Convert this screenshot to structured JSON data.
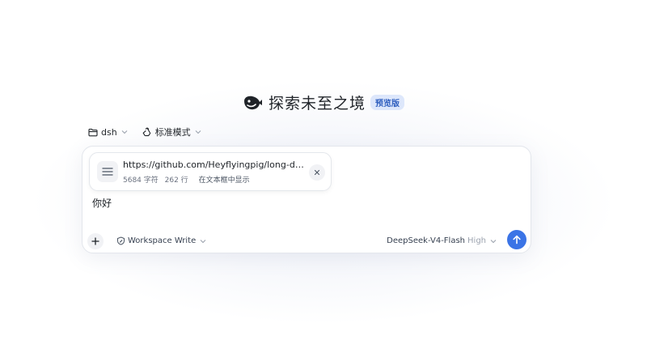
{
  "brand": {
    "title": "探索未至之境",
    "badge": "预览版"
  },
  "selectors": {
    "folder": "dsh",
    "mode": "标准模式"
  },
  "attachment": {
    "url": "https://github.com/Heyflyingpig/long-draft-in...",
    "chars": "5684 字符",
    "lines": "262 行",
    "action": "在文本框中显示"
  },
  "prompt": {
    "text": "你好"
  },
  "toolbar": {
    "workspace": "Workspace Write",
    "model": "DeepSeek-V4-Flash",
    "level": "High"
  },
  "colors": {
    "accent": "#3b74e6",
    "badge_bg": "#dde7fb",
    "badge_text": "#2f5fbf"
  },
  "icons": {
    "logo": "whale-logo-icon",
    "folder": "folder-icon",
    "mode": "recycle-icon",
    "attachment": "menu-lines-icon",
    "close": "close-icon",
    "add": "plus-icon",
    "workspace": "shield-edit-icon",
    "chevron": "chevron-down-icon",
    "send": "arrow-up-icon"
  }
}
